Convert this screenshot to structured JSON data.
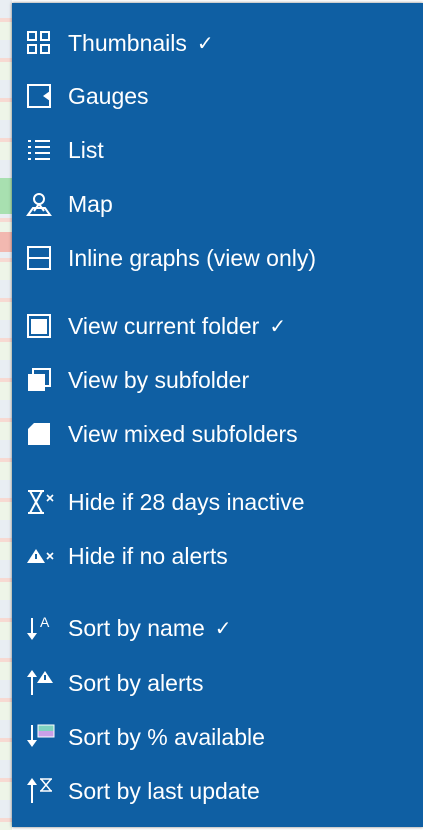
{
  "menu": {
    "items": [
      {
        "label": "Thumbnails",
        "icon": "thumbnails-icon",
        "checked": true
      },
      {
        "label": "Gauges",
        "icon": "gauges-icon",
        "checked": false
      },
      {
        "label": "List",
        "icon": "list-icon",
        "checked": false
      },
      {
        "label": "Map",
        "icon": "map-pin-icon",
        "checked": false
      },
      {
        "label": "Inline graphs (view only)",
        "icon": "inline-graphs-icon",
        "checked": false
      },
      {
        "label": "View current folder",
        "icon": "current-folder-icon",
        "checked": true
      },
      {
        "label": "View by subfolder",
        "icon": "subfolder-icon",
        "checked": false
      },
      {
        "label": "View mixed subfolders",
        "icon": "mixed-subfolders-icon",
        "checked": false
      },
      {
        "label": "Hide if 28 days inactive",
        "icon": "hourglass-x-icon",
        "checked": false
      },
      {
        "label": "Hide if no alerts",
        "icon": "alert-x-icon",
        "checked": false
      },
      {
        "label": "Sort by name",
        "icon": "sort-name-icon",
        "checked": true
      },
      {
        "label": "Sort by alerts",
        "icon": "sort-alerts-icon",
        "checked": false
      },
      {
        "label": "Sort by % available",
        "icon": "sort-available-icon",
        "checked": false
      },
      {
        "label": "Sort by last update",
        "icon": "sort-last-update-icon",
        "checked": false
      }
    ],
    "check_mark": "✓"
  },
  "colors": {
    "menu_bg": "#0f5fa3",
    "text": "#ffffff"
  }
}
